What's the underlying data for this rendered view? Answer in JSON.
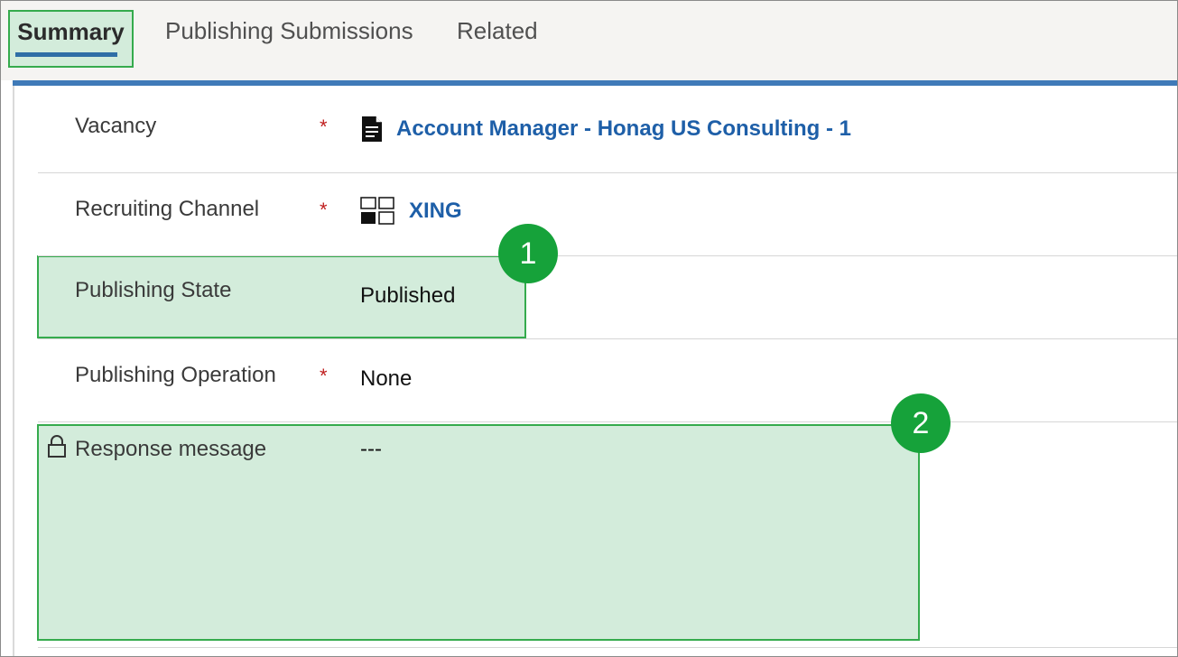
{
  "tabs": [
    {
      "label": "Summary",
      "selected": true
    },
    {
      "label": "Publishing Submissions"
    },
    {
      "label": "Related"
    }
  ],
  "fields": {
    "vacancy": {
      "label": "Vacancy",
      "required_mark": "*",
      "value": "Account Manager - Honag US Consulting - 1"
    },
    "recruiting_channel": {
      "label": "Recruiting Channel",
      "required_mark": "*",
      "value": "XING"
    },
    "publishing_state": {
      "label": "Publishing State",
      "value": "Published"
    },
    "publishing_operation": {
      "label": "Publishing Operation",
      "required_mark": "*",
      "value": "None"
    },
    "response_message": {
      "label": "Response message",
      "value": "---",
      "locked": true
    }
  },
  "callouts": [
    "1",
    "2"
  ],
  "colors": {
    "highlight_fill": "#d3ecdb",
    "highlight_border": "#35ab4d",
    "badge": "#16a23a",
    "link": "#1e5fa8",
    "accent_bar": "#3f7ab8",
    "required": "#c02020"
  }
}
